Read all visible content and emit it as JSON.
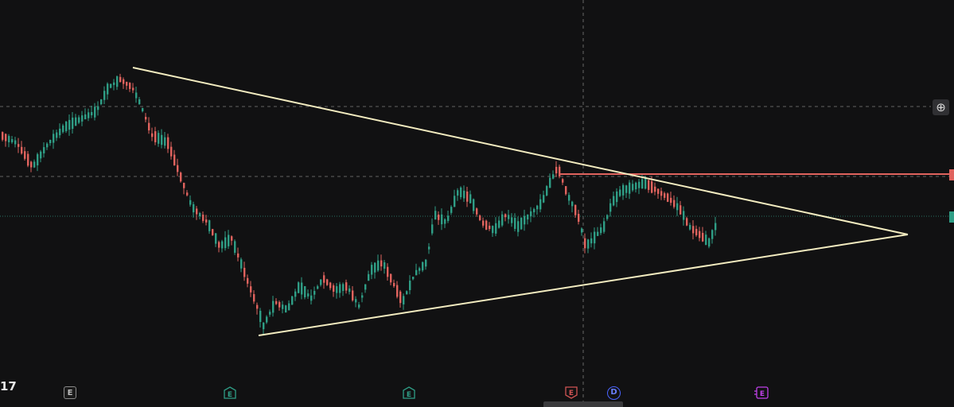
{
  "colors": {
    "background": "#111112",
    "bull": "#2f9e86",
    "bear": "#e0635e",
    "trendline": "#f3ecc0",
    "resistance": "#e0635e",
    "crosshair": "#8a8a8a",
    "price_line": "#2f9e86"
  },
  "toolbar": {
    "logo_text": "17",
    "plus_icon": "plus-circle-icon"
  },
  "events": [
    {
      "label": "E",
      "kind": "earnings",
      "color": "#8a8a8a"
    },
    {
      "label": "E",
      "kind": "earnings",
      "color": "#2f9e86"
    },
    {
      "label": "E",
      "kind": "earnings",
      "color": "#2f9e86"
    },
    {
      "label": "E",
      "kind": "earnings",
      "color": "#d05454"
    },
    {
      "label": "D",
      "kind": "dividend",
      "color": "#4a64ff"
    },
    {
      "label": "E",
      "kind": "earnings",
      "color": "#c040e8"
    }
  ]
}
